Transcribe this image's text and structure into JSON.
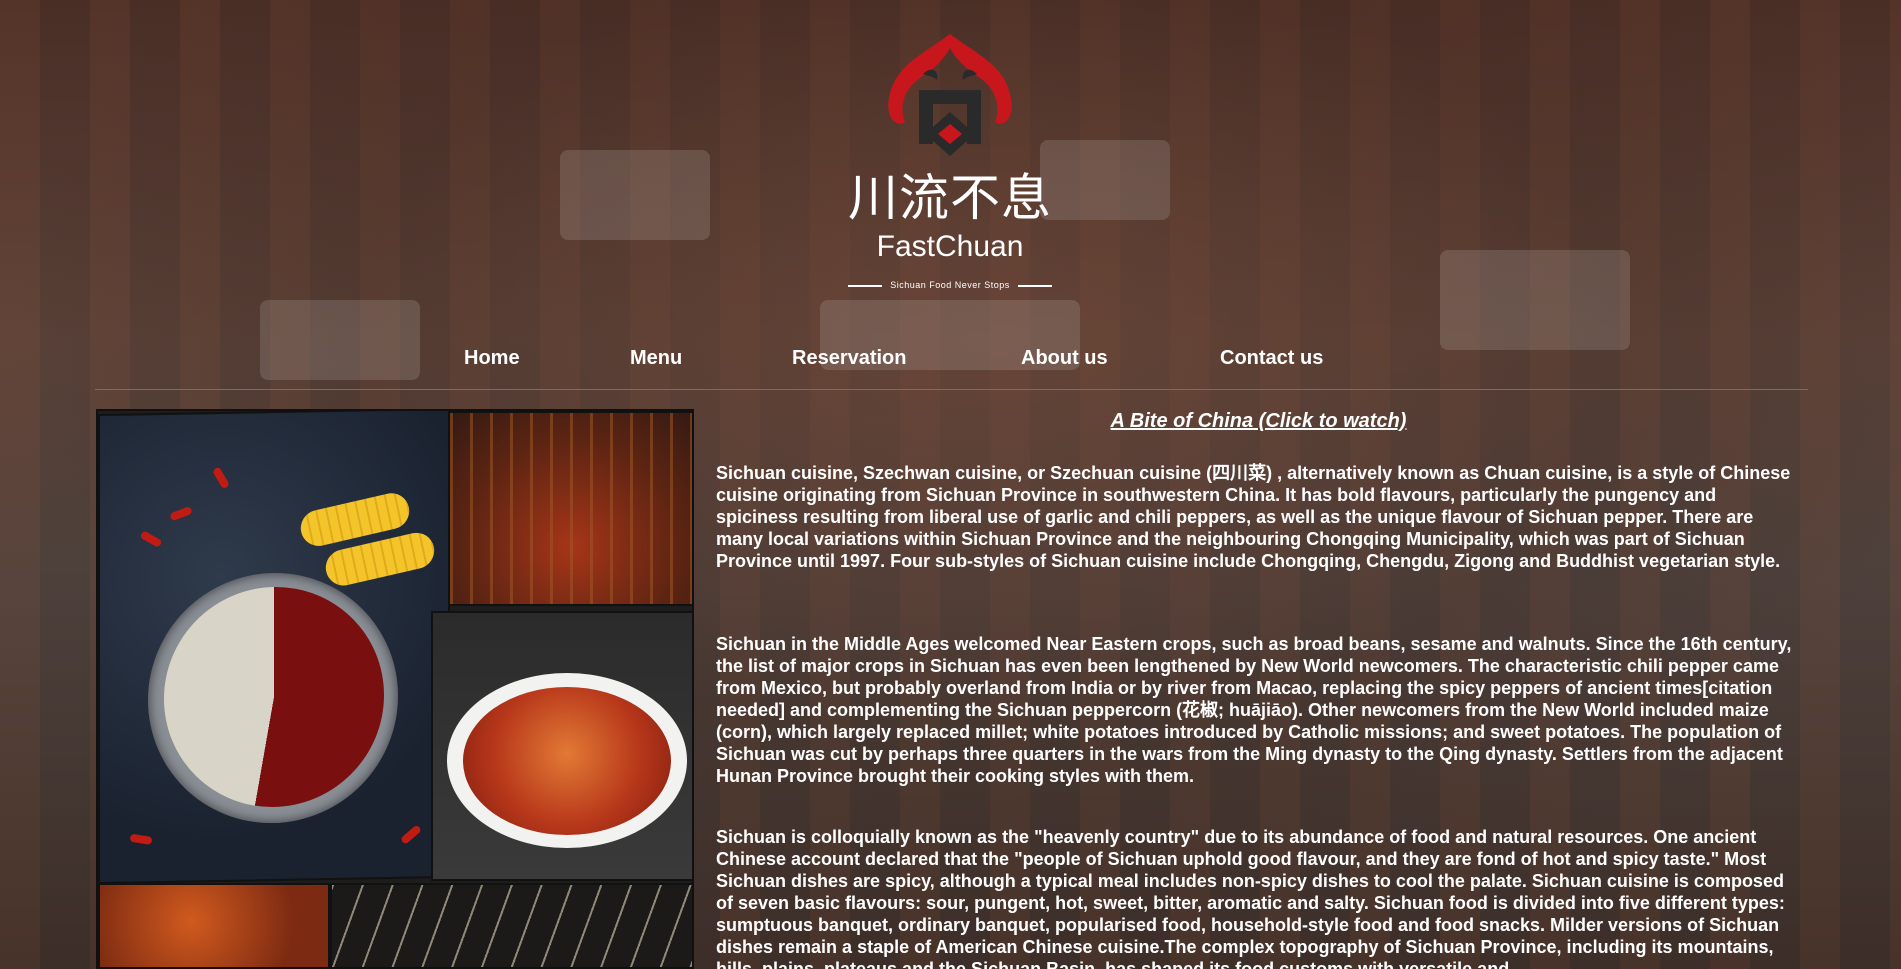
{
  "brand": {
    "chinese_name": "川流不息",
    "english_name": "FastChuan",
    "tagline": "Sichuan Food Never Stops"
  },
  "nav": {
    "items": [
      {
        "label": "Home"
      },
      {
        "label": "Menu"
      },
      {
        "label": "Reservation"
      },
      {
        "label": "About us"
      },
      {
        "label": "Contact us"
      }
    ]
  },
  "content": {
    "video_link": "A Bite of China (Click to watch)",
    "paragraphs": [
      "Sichuan cuisine, Szechwan cuisine, or Szechuan cuisine (四川菜) , alternatively known as Chuan cuisine, is a style of Chinese cuisine originating from Sichuan Province in southwestern China. It has bold flavours, particularly the pungency and spiciness resulting from liberal use of garlic and chili peppers, as well as the unique flavour of Sichuan pepper. There are many local variations within Sichuan Province and the neighbouring Chongqing Municipality, which was part of Sichuan Province until 1997. Four sub-styles of Sichuan cuisine include Chongqing, Chengdu, Zigong and Buddhist vegetarian style.",
      "Sichuan in the Middle Ages welcomed Near Eastern crops, such as broad beans, sesame and walnuts. Since the 16th century, the list of major crops in Sichuan has even been lengthened by New World newcomers. The characteristic chili pepper came from Mexico, but probably overland from India or by river from Macao, replacing the spicy peppers of ancient times[citation needed] and complementing the Sichuan peppercorn (花椒; huājiāo). Other newcomers from the New World included maize (corn), which largely replaced millet; white potatoes introduced by Catholic missions; and sweet potatoes. The population of Sichuan was cut by perhaps three quarters in the wars from the Ming dynasty to the Qing dynasty. Settlers from the adjacent Hunan Province brought their cooking styles with them.",
      "Sichuan is colloquially known as the \"heavenly country\" due to its abundance of food and natural resources. One ancient Chinese account declared that the \"people of Sichuan uphold good flavour, and they are fond of hot and spicy taste.\" Most Sichuan dishes are spicy, although a typical meal includes non-spicy dishes to cool the palate. Sichuan cuisine is composed of seven basic flavours: sour, pungent, hot, sweet, bitter, aromatic and salty. Sichuan food is divided into five different types: sumptuous banquet, ordinary banquet, popularised food, household-style food and food snacks. Milder versions of Sichuan dishes remain a staple of American Chinese cuisine.The complex topography of Sichuan Province, including its mountains, hills, plains, plateaus and the Sichuan Basin, has shaped its food customs with versatile and"
    ]
  },
  "colors": {
    "accent_red": "#c8161d",
    "divider": "#d44a2c",
    "text": "#ffffff"
  }
}
